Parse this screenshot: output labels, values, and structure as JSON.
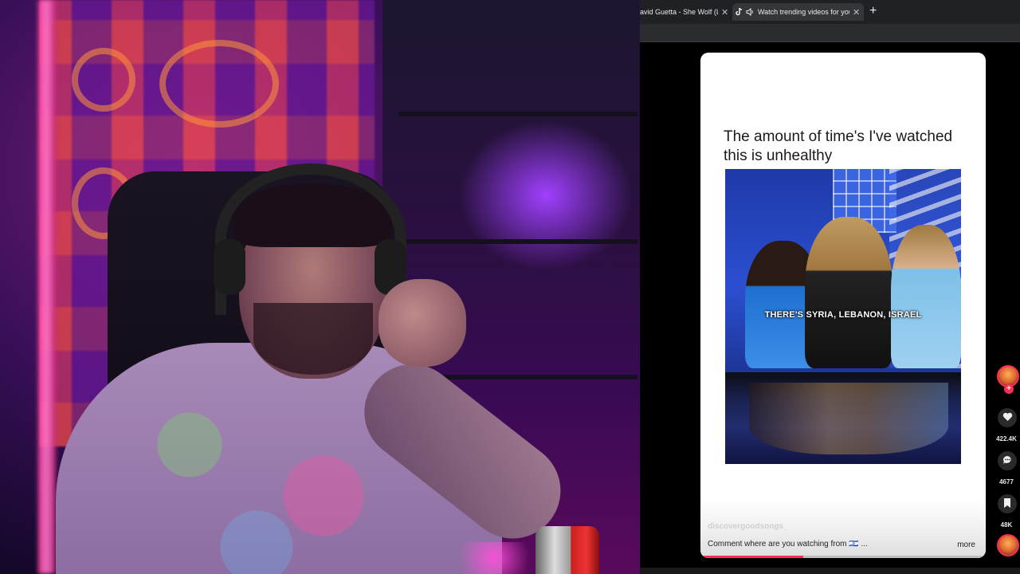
{
  "browser": {
    "tabs": [
      {
        "title": "avid Guetta - She Wolf (Lyric",
        "close": "✕",
        "icon": ""
      },
      {
        "title": "Watch trending videos for you",
        "close": "✕",
        "icon": "tiktok-icon",
        "audio_icon": "speaker-icon"
      }
    ],
    "new_tab": "+"
  },
  "video": {
    "caption": "The amount of time's I've watched this is unhealthy",
    "subtitle": "THERE'S SYRIA, LEBANON, ISRAEL",
    "username": "discovergoodsongs_",
    "description": "Comment where are you watching from 🇮🇱 ...",
    "more": "more",
    "progress": 0.36
  },
  "rail": {
    "likes": "422.4K",
    "comments": "4677",
    "saves": "48K",
    "like_icon": "heart-icon",
    "comment_icon": "comment-icon",
    "save_icon": "bookmark-icon",
    "follow": "+"
  },
  "colors": {
    "accent": "#fe2c55",
    "tab_bg": "#202124",
    "active_tab_bg": "#35363a"
  }
}
